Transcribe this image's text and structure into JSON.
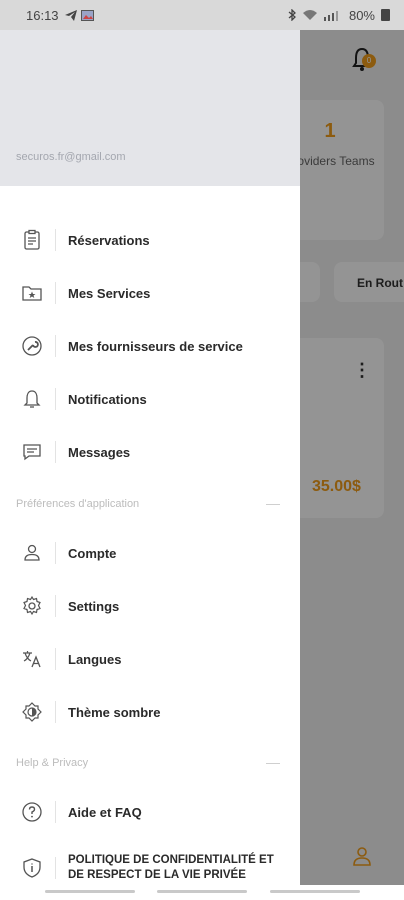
{
  "status_bar": {
    "time": "16:13",
    "battery": "80%",
    "icons": [
      "telegram-icon",
      "gallery-icon",
      "bluetooth-icon",
      "wifi-icon",
      "signal-icon",
      "battery-icon"
    ]
  },
  "drawer": {
    "email": "securos.fr@gmail.com",
    "items_main": [
      {
        "label": "Réservations",
        "icon": "clipboard-icon"
      },
      {
        "label": "Mes Services",
        "icon": "folder-star-icon"
      },
      {
        "label": "Mes fournisseurs de service",
        "icon": "wrench-circle-icon"
      },
      {
        "label": "Notifications",
        "icon": "bell-icon"
      },
      {
        "label": "Messages",
        "icon": "chat-icon"
      }
    ],
    "section_app_prefs": "Préférences d'application",
    "items_prefs": [
      {
        "label": "Compte",
        "icon": "person-icon"
      },
      {
        "label": "Settings",
        "icon": "gear-icon"
      },
      {
        "label": "Langues",
        "icon": "translate-icon"
      },
      {
        "label": "Thème sombre",
        "icon": "brightness-icon"
      }
    ],
    "section_help": "Help & Privacy",
    "items_help": [
      {
        "label": "Aide et FAQ",
        "icon": "help-circle-icon"
      },
      {
        "label": "POLITIQUE DE CONFIDENTIALITÉ ET DE RESPECT DE LA VIE PRIVÉE",
        "icon": "shield-icon"
      }
    ]
  },
  "background": {
    "notification_badge": "0",
    "providers_count": "1",
    "providers_label": "Providers Teams",
    "tab_label": "En Rout",
    "price": "35.00$"
  },
  "colors": {
    "accent": "#f29d1a",
    "drawer_header": "#e4e5e9",
    "menu_text": "#2a2a2a",
    "section_text": "#bcbcbc"
  }
}
